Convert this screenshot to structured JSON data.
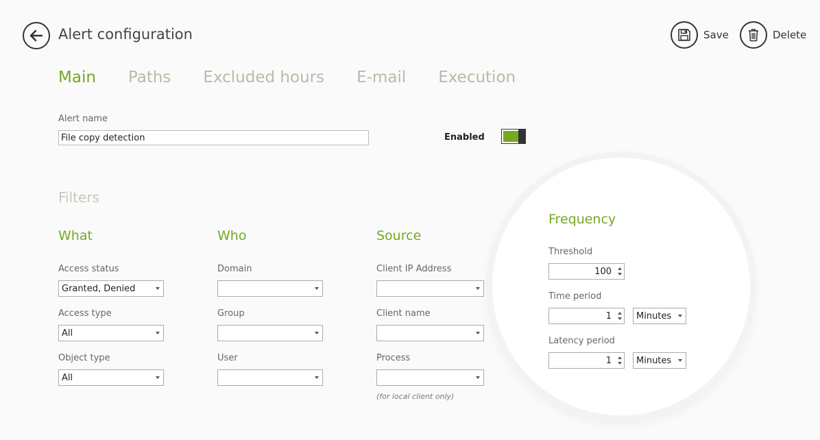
{
  "header": {
    "title": "Alert configuration",
    "save_label": "Save",
    "delete_label": "Delete"
  },
  "tabs": [
    {
      "label": "Main",
      "active": true
    },
    {
      "label": "Paths",
      "active": false
    },
    {
      "label": "Excluded hours",
      "active": false
    },
    {
      "label": "E-mail",
      "active": false
    },
    {
      "label": "Execution",
      "active": false
    }
  ],
  "main": {
    "alert_name_label": "Alert name",
    "alert_name_value": "File copy detection",
    "enabled_label": "Enabled",
    "enabled": true
  },
  "filters": {
    "title": "Filters",
    "what": {
      "heading": "What",
      "access_status_label": "Access status",
      "access_status_value": "Granted, Denied",
      "access_type_label": "Access type",
      "access_type_value": "All",
      "object_type_label": "Object type",
      "object_type_value": "All"
    },
    "who": {
      "heading": "Who",
      "domain_label": "Domain",
      "domain_value": "",
      "group_label": "Group",
      "group_value": "",
      "user_label": "User",
      "user_value": ""
    },
    "source": {
      "heading": "Source",
      "client_ip_label": "Client IP Address",
      "client_ip_value": "",
      "client_name_label": "Client name",
      "client_name_value": "",
      "process_label": "Process",
      "process_value": "",
      "process_note": "(for local client only)"
    }
  },
  "frequency": {
    "heading": "Frequency",
    "threshold_label": "Threshold",
    "threshold_value": "100",
    "time_period_label": "Time period",
    "time_period_value": "1",
    "time_period_unit": "Minutes",
    "latency_period_label": "Latency period",
    "latency_period_value": "1",
    "latency_period_unit": "Minutes"
  },
  "colors": {
    "accent": "#74a824",
    "inactive_tab": "#b5bca8",
    "toggle_on": "#77a820"
  }
}
